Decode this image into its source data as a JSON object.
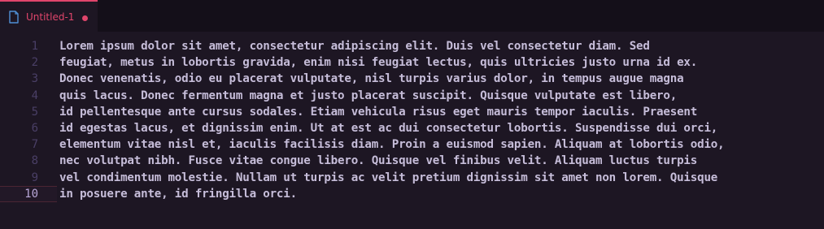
{
  "tab": {
    "title": "Untitled-1",
    "icon": "file-icon",
    "dirty": true
  },
  "editor": {
    "active_line": 10,
    "lines": [
      {
        "num": "1",
        "text": "Lorem ipsum dolor sit amet, consectetur adipiscing elit. Duis vel consectetur diam. Sed"
      },
      {
        "num": "2",
        "text": "feugiat, metus in lobortis gravida, enim nisi feugiat lectus, quis ultricies justo urna id ex."
      },
      {
        "num": "3",
        "text": "Donec venenatis, odio eu placerat vulputate, nisl turpis varius dolor, in tempus augue magna"
      },
      {
        "num": "4",
        "text": "quis lacus. Donec fermentum magna et justo placerat suscipit. Quisque vulputate est libero,"
      },
      {
        "num": "5",
        "text": "id pellentesque ante cursus sodales. Etiam vehicula risus eget mauris tempor iaculis. Praesent"
      },
      {
        "num": "6",
        "text": "id egestas lacus, et dignissim enim. Ut at est ac dui consectetur lobortis. Suspendisse dui orci,"
      },
      {
        "num": "7",
        "text": "elementum vitae nisl et, iaculis facilisis diam. Proin a euismod sapien. Aliquam at lobortis odio,"
      },
      {
        "num": "8",
        "text": "nec volutpat nibh. Fusce vitae congue libero. Quisque vel finibus velit. Aliquam luctus turpis"
      },
      {
        "num": "9",
        "text": "vel condimentum molestie. Nullam ut turpis ac velit pretium dignissim sit amet non lorem. Quisque"
      },
      {
        "num": "10",
        "text": "in posuere ante, id fringilla orci."
      }
    ]
  },
  "colors": {
    "accent": "#e0456b",
    "background": "#1d1623",
    "text": "#c6bdd9",
    "line_number": "#4a3f66"
  }
}
